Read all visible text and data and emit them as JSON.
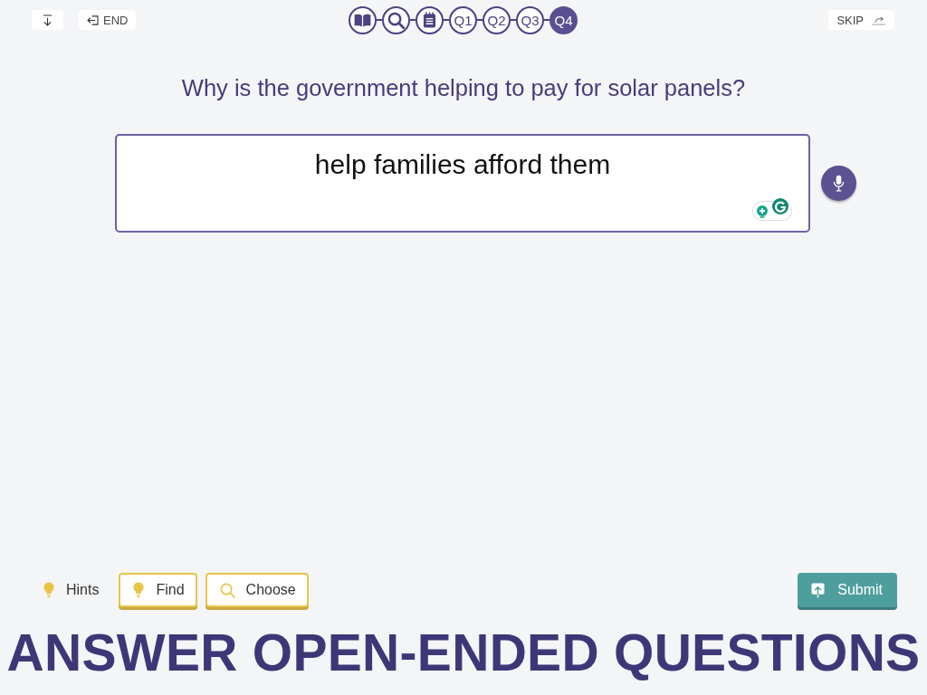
{
  "top_bar": {
    "end_button": {
      "label": "END"
    },
    "skip_button": {
      "label": "SKIP"
    }
  },
  "steps": [
    {
      "kind": "reading",
      "selected": false
    },
    {
      "kind": "search",
      "selected": false
    },
    {
      "kind": "notes",
      "selected": false
    },
    {
      "kind": "question",
      "label": "Q1",
      "selected": false
    },
    {
      "kind": "question",
      "label": "Q2",
      "selected": false
    },
    {
      "kind": "question",
      "label": "Q3",
      "selected": false
    },
    {
      "kind": "question",
      "label": "Q4",
      "selected": true
    }
  ],
  "question": "Why is the government helping to pay for solar panels?",
  "answer": {
    "value": "help families afford them"
  },
  "tools": [
    {
      "kind": "label",
      "label": "Hints"
    },
    {
      "kind": "find",
      "label": "Find"
    },
    {
      "kind": "choose",
      "label": "Choose"
    }
  ],
  "submit_button": {
    "label": "Submit"
  },
  "banner": "ANSWER OPEN-ENDED QUESTIONS"
}
